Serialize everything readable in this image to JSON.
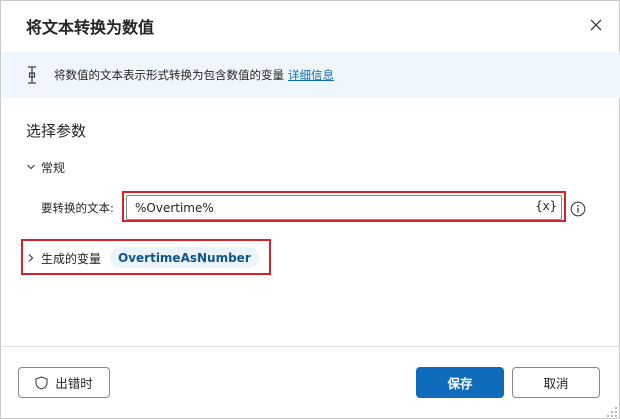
{
  "dialog": {
    "title": "将文本转换为数值",
    "close_icon": "close-icon"
  },
  "info": {
    "icon": "text-cursor-icon",
    "text": "将数值的文本表示形式转换为包含数值的变量",
    "link_label": "详细信息"
  },
  "section": {
    "title": "选择参数"
  },
  "general": {
    "label": "常规",
    "expanded": true
  },
  "text_field": {
    "label": "要转换的文本:",
    "value": "%Overtime%",
    "variable_button": "{x}",
    "help_icon": "info-icon"
  },
  "produced_variables": {
    "label": "生成的变量",
    "expanded": false,
    "variable": "OvertimeAsNumber"
  },
  "footer": {
    "on_error_label": "出错时",
    "save_label": "保存",
    "cancel_label": "取消"
  },
  "colors": {
    "accent": "#0f6cbd",
    "highlight": "#d6222a",
    "info_bar": "#eff6fc",
    "chip": "#ebf3fc"
  }
}
